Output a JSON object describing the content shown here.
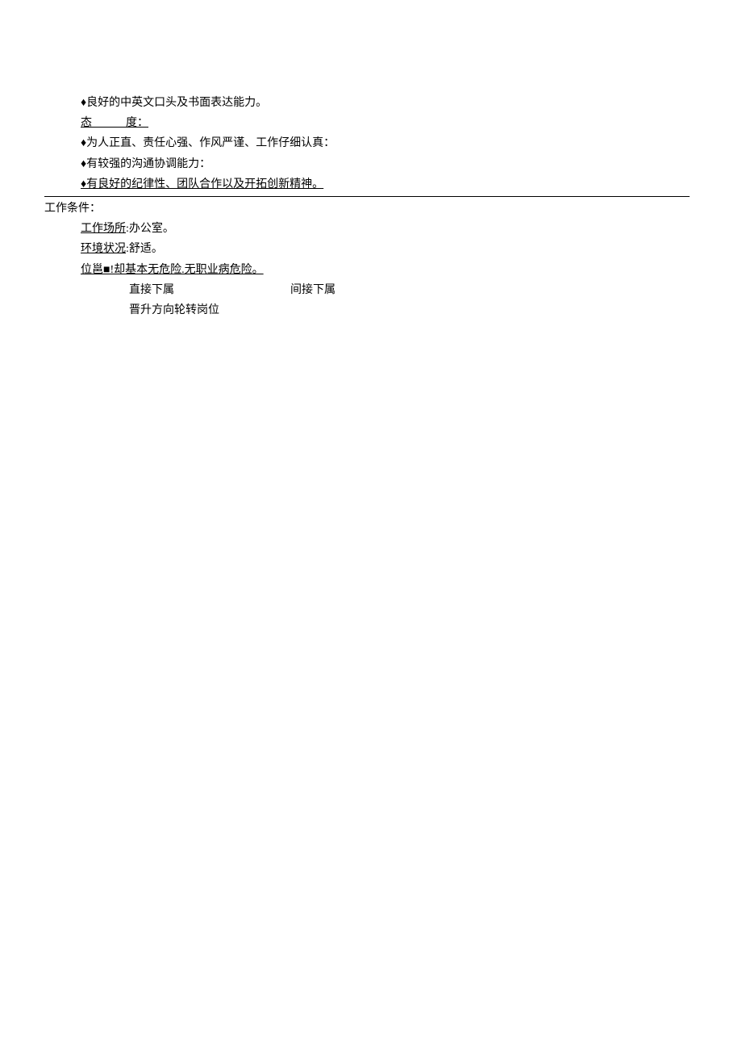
{
  "bullets_top": [
    "♦良好的中英文口头及书面表达能力。"
  ],
  "attitude_label": "态　　　度：",
  "attitude_items": [
    "♦为人正直、责任心强、作风严谨、工作仔细认真：",
    "♦有较强的沟通协调能力：",
    "♦有良好的纪律性、团队合作以及开拓创新精神。"
  ],
  "work_conditions_label": "工作条件：",
  "work_place_label": "工作场所",
  "work_place_value": ":办公室。",
  "env_label": "环境状况",
  "env_value": ":舒适。",
  "danger_line": "位邕■!却基本无危险.无职业病危险。",
  "row1_col1": "直接下属",
  "row1_col2": "间接下属",
  "row2": "晋升方向轮转岗位"
}
